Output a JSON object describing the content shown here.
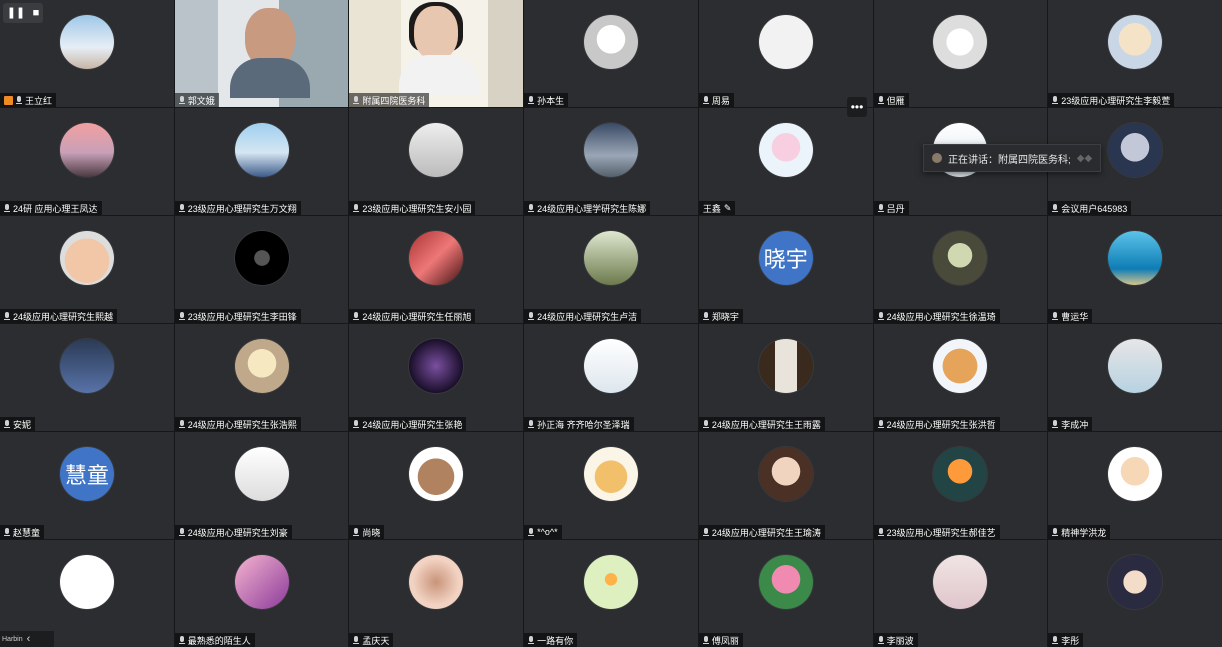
{
  "controls": {
    "pause_label": "❚❚",
    "stop_label": "■"
  },
  "speaking_tooltip": {
    "text": "正在讲话：附属四院医务科;"
  },
  "bottom_left": {
    "label": "Harbin",
    "chevron": "‹"
  },
  "more_button": {
    "label": "•••"
  },
  "colors": {
    "speaking_border": "#2fb36a",
    "host_badge": "#f08a24",
    "tile_bg": "#2b2d30"
  },
  "participants": [
    {
      "name": "王立红",
      "avatar": "g-sky",
      "badge": "host-icon"
    },
    {
      "name": "郭文娥",
      "video": "vid1"
    },
    {
      "name": "附属四院医务科",
      "video": "vid2",
      "speaking": true
    },
    {
      "name": "孙本生",
      "avatar": "g-plush"
    },
    {
      "name": "周易",
      "avatar": "g-gray"
    },
    {
      "name": "但雁",
      "avatar": "g-knot"
    },
    {
      "name": "23级应用心理研究生李毅萱",
      "avatar": "g-cat"
    },
    {
      "name": "24研 应用心理王凤达",
      "avatar": "g-sunset"
    },
    {
      "name": "23级应用心理研究生万文翔",
      "avatar": "g-beach"
    },
    {
      "name": "23级应用心理研究生安小园",
      "avatar": "g-monochrome"
    },
    {
      "name": "24级应用心理学研究生陈娜",
      "avatar": "g-mountain"
    },
    {
      "name": "王鑫",
      "avatar": "g-pig",
      "edit": true
    },
    {
      "name": "吕丹",
      "avatar": "g-doc"
    },
    {
      "name": "会议用户645983",
      "avatar": "g-bunny"
    },
    {
      "name": "24级应用心理研究生熙越",
      "avatar": "g-face"
    },
    {
      "name": "23级应用心理研究生李田锋",
      "avatar": "g-dark"
    },
    {
      "name": "24级应用心理研究生任丽旭",
      "avatar": "g-red"
    },
    {
      "name": "24级应用心理研究生卢洁",
      "avatar": "g-forest"
    },
    {
      "name": "郑晓宇",
      "avatar_text": "晓宇"
    },
    {
      "name": "24级应用心理研究生徐温琦",
      "avatar": "g-cowdoll"
    },
    {
      "name": "曹运华",
      "avatar": "g-ocean"
    },
    {
      "name": "安妮",
      "avatar": "g-blackbird"
    },
    {
      "name": "24级应用心理研究生张浩熙",
      "avatar": "g-cat2"
    },
    {
      "name": "24级应用心理研究生张艳",
      "avatar": "g-galaxy"
    },
    {
      "name": "孙正海  齐齐哈尔圣泽瑞",
      "avatar": "g-doc"
    },
    {
      "name": "24级应用心理研究生王雨露",
      "avatar": "g-door"
    },
    {
      "name": "24级应用心理研究生张洪哲",
      "avatar": "g-cartoon"
    },
    {
      "name": "李成冲",
      "avatar": "g-kid"
    },
    {
      "name": "赵慧童",
      "avatar_text": "慧童"
    },
    {
      "name": "24级应用心理研究生刘豪",
      "avatar": "g-sketch"
    },
    {
      "name": "尚晓",
      "avatar": "g-rabbit"
    },
    {
      "name": "*^o^*",
      "avatar": "g-dog"
    },
    {
      "name": "24级应用心理研究生王瑜涛",
      "avatar": "g-girl"
    },
    {
      "name": "23级应用心理研究生郝佳艺",
      "avatar": "g-rooster"
    },
    {
      "name": "精神学洪龙",
      "avatar": "g-glasses"
    },
    {
      "name": "",
      "avatar": "g-white"
    },
    {
      "name": "最熟悉的陌生人",
      "avatar": "g-pinkflower"
    },
    {
      "name": "孟庆天",
      "avatar": "g-swirl"
    },
    {
      "name": "一路有你",
      "avatar": "g-green"
    },
    {
      "name": "傅凤丽",
      "avatar": "g-lotus"
    },
    {
      "name": "李丽波",
      "avatar": "g-branch"
    },
    {
      "name": "李彤",
      "avatar": "g-anime"
    }
  ]
}
